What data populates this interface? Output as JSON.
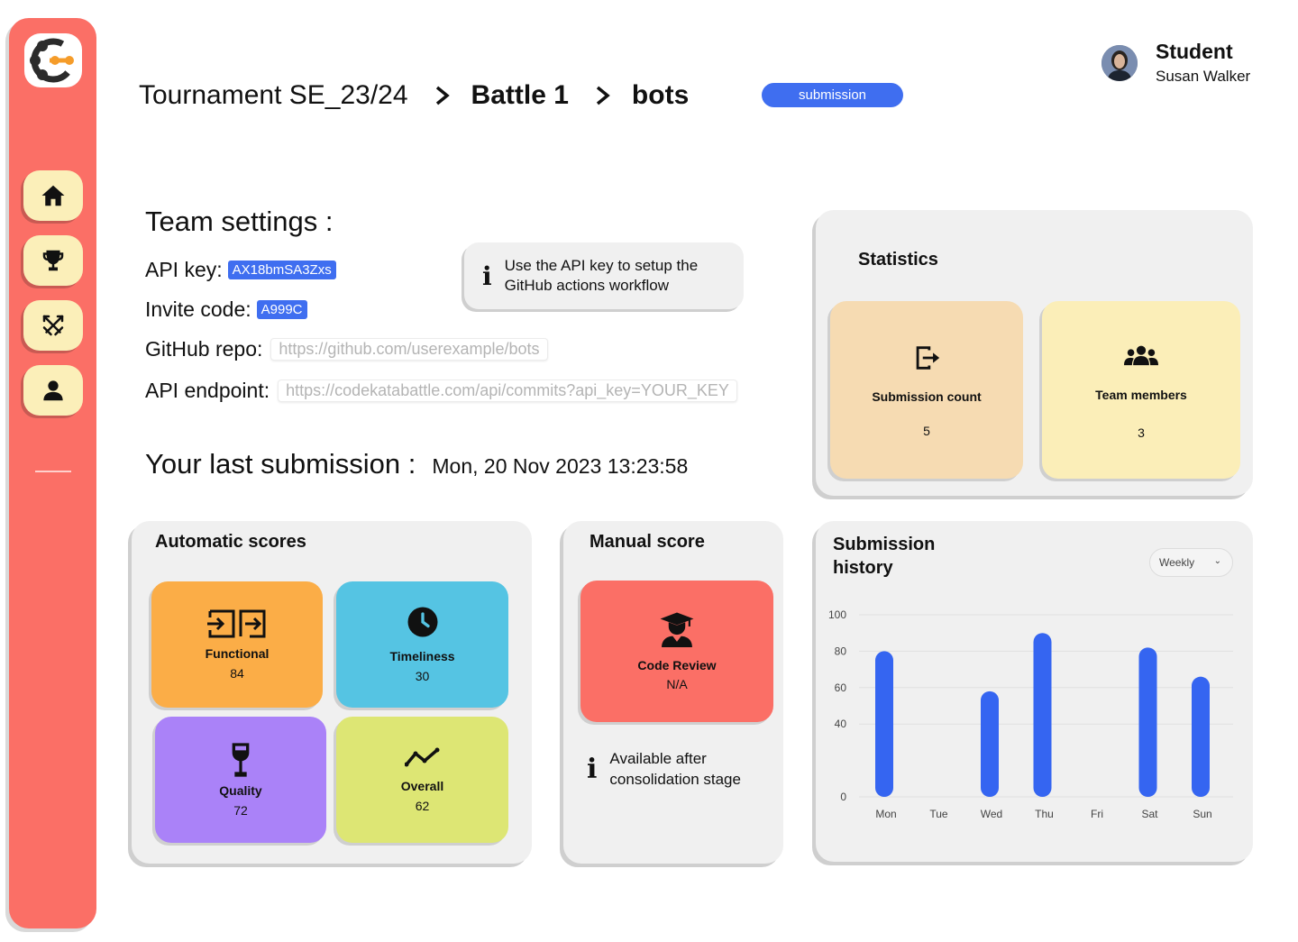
{
  "breadcrumb": {
    "tournament": "Tournament SE_23/24",
    "battle": "Battle 1",
    "team": "bots",
    "status_badge": "submission"
  },
  "user": {
    "role": "Student",
    "name": "Susan Walker"
  },
  "sidebar": {
    "items": [
      {
        "icon": "home-icon"
      },
      {
        "icon": "trophy-icon"
      },
      {
        "icon": "swords-icon"
      },
      {
        "icon": "user-icon"
      }
    ]
  },
  "team_settings": {
    "title": "Team settings :",
    "api_key_label": "API key:",
    "api_key_value": "AX18bmSA3Zxs",
    "invite_code_label": "Invite code:",
    "invite_code_value": "A999C",
    "github_repo_label": "GitHub repo:",
    "github_repo_value": "https://github.com/userexample/bots",
    "api_endpoint_label": "API endpoint:",
    "api_endpoint_value": "https://codekatabattle.com/api/commits?api_key=YOUR_KEY",
    "tip": "Use the API key to setup the GitHub actions workflow"
  },
  "last_submission": {
    "label": "Your last submission :",
    "value": "Mon, 20 Nov 2023 13:23:58"
  },
  "statistics": {
    "title": "Statistics",
    "submission_count_label": "Submission count",
    "submission_count_value": "5",
    "team_members_label": "Team members",
    "team_members_value": "3"
  },
  "automatic_scores": {
    "title": "Automatic scores",
    "functional_label": "Functional",
    "functional_value": "84",
    "timeliness_label": "Timeliness",
    "timeliness_value": "30",
    "quality_label": "Quality",
    "quality_value": "72",
    "overall_label": "Overall",
    "overall_value": "62"
  },
  "manual_score": {
    "title": "Manual score",
    "code_review_label": "Code Review",
    "code_review_value": "N/A",
    "note": "Available after consolidation stage"
  },
  "submission_history": {
    "title_line1": "Submission",
    "title_line2": "history",
    "period": "Weekly"
  },
  "colors": {
    "sidebar": "#fb6f66",
    "accent_blue": "#3f6ef0",
    "functional": "#fbad47",
    "timeliness": "#55c4e3",
    "quality": "#aa82f8",
    "overall": "#dde674",
    "code_review": "#fb6f66",
    "submission_count": "#f6dbb2",
    "team_members": "#fbeeb8",
    "bar": "#3565f1"
  },
  "chart_data": {
    "type": "bar",
    "categories": [
      "Mon",
      "Tue",
      "Wed",
      "Thu",
      "Fri",
      "Sat",
      "Sun"
    ],
    "values": [
      80,
      0,
      58,
      90,
      0,
      82,
      66
    ],
    "yticks": [
      0,
      40,
      60,
      80,
      100
    ],
    "ylim": [
      0,
      100
    ],
    "grid": true
  }
}
